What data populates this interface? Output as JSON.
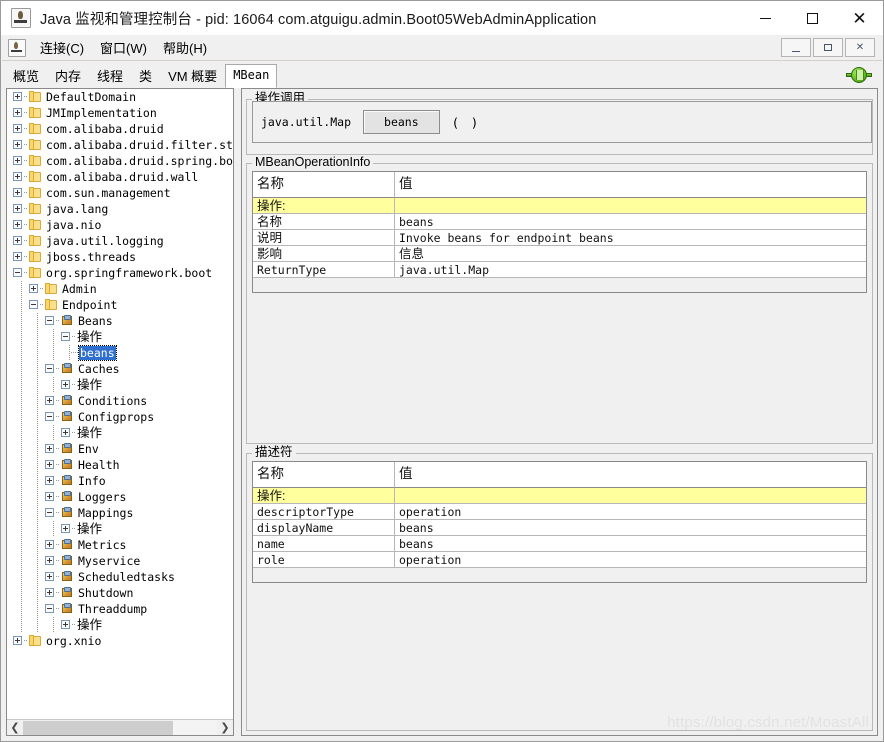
{
  "window": {
    "title": "Java 监视和管理控制台 - pid: 16064 com.atguigu.admin.Boot05WebAdminApplication",
    "app_icon": "java-cup-icon",
    "controls": {
      "minimize": "minimize-icon",
      "maximize": "maximize-icon",
      "close": "close-icon"
    }
  },
  "menubar": {
    "icon": "java-cup-icon",
    "items": [
      {
        "label": "连接(C)",
        "mnemonic": "C"
      },
      {
        "label": "窗口(W)",
        "mnemonic": "W"
      },
      {
        "label": "帮助(H)",
        "mnemonic": "H"
      }
    ],
    "internal_controls": {
      "minimize": "minimize-icon",
      "restore": "restore-icon",
      "close": "close-icon"
    }
  },
  "tabs": {
    "items": [
      {
        "label": "概览",
        "selected": false
      },
      {
        "label": "内存",
        "selected": false
      },
      {
        "label": "线程",
        "selected": false
      },
      {
        "label": "类",
        "selected": false
      },
      {
        "label": "VM 概要",
        "selected": false
      },
      {
        "label": "MBean",
        "selected": true
      }
    ],
    "status_icon": "connected-plug-icon"
  },
  "tree": {
    "nodes": [
      {
        "label": "DefaultDomain",
        "depth": 0,
        "handle": "plus",
        "icon": "folder"
      },
      {
        "label": "JMImplementation",
        "depth": 0,
        "handle": "plus",
        "icon": "folder"
      },
      {
        "label": "com.alibaba.druid",
        "depth": 0,
        "handle": "plus",
        "icon": "folder"
      },
      {
        "label": "com.alibaba.druid.filter.stat",
        "depth": 0,
        "handle": "plus",
        "icon": "folder"
      },
      {
        "label": "com.alibaba.druid.spring.boot.au",
        "depth": 0,
        "handle": "plus",
        "icon": "folder"
      },
      {
        "label": "com.alibaba.druid.wall",
        "depth": 0,
        "handle": "plus",
        "icon": "folder"
      },
      {
        "label": "com.sun.management",
        "depth": 0,
        "handle": "plus",
        "icon": "folder"
      },
      {
        "label": "java.lang",
        "depth": 0,
        "handle": "plus",
        "icon": "folder"
      },
      {
        "label": "java.nio",
        "depth": 0,
        "handle": "plus",
        "icon": "folder"
      },
      {
        "label": "java.util.logging",
        "depth": 0,
        "handle": "plus",
        "icon": "folder"
      },
      {
        "label": "jboss.threads",
        "depth": 0,
        "handle": "plus",
        "icon": "folder"
      },
      {
        "label": "org.springframework.boot",
        "depth": 0,
        "handle": "minus",
        "icon": "folder"
      },
      {
        "label": "Admin",
        "depth": 1,
        "handle": "plus",
        "icon": "folder"
      },
      {
        "label": "Endpoint",
        "depth": 1,
        "handle": "minus",
        "icon": "folder"
      },
      {
        "label": "Beans",
        "depth": 2,
        "handle": "minus",
        "icon": "mbean"
      },
      {
        "label": "操作",
        "depth": 3,
        "handle": "minus",
        "icon": "none",
        "cjk": true
      },
      {
        "label": "beans",
        "depth": 4,
        "handle": "none",
        "icon": "none",
        "selected": true
      },
      {
        "label": "Caches",
        "depth": 2,
        "handle": "minus",
        "icon": "mbean"
      },
      {
        "label": "操作",
        "depth": 3,
        "handle": "plus",
        "icon": "none",
        "cjk": true
      },
      {
        "label": "Conditions",
        "depth": 2,
        "handle": "plus",
        "icon": "mbean"
      },
      {
        "label": "Configprops",
        "depth": 2,
        "handle": "minus",
        "icon": "mbean"
      },
      {
        "label": "操作",
        "depth": 3,
        "handle": "plus",
        "icon": "none",
        "cjk": true
      },
      {
        "label": "Env",
        "depth": 2,
        "handle": "plus",
        "icon": "mbean"
      },
      {
        "label": "Health",
        "depth": 2,
        "handle": "plus",
        "icon": "mbean"
      },
      {
        "label": "Info",
        "depth": 2,
        "handle": "plus",
        "icon": "mbean"
      },
      {
        "label": "Loggers",
        "depth": 2,
        "handle": "plus",
        "icon": "mbean"
      },
      {
        "label": "Mappings",
        "depth": 2,
        "handle": "minus",
        "icon": "mbean"
      },
      {
        "label": "操作",
        "depth": 3,
        "handle": "plus",
        "icon": "none",
        "cjk": true
      },
      {
        "label": "Metrics",
        "depth": 2,
        "handle": "plus",
        "icon": "mbean"
      },
      {
        "label": "Myservice",
        "depth": 2,
        "handle": "plus",
        "icon": "mbean"
      },
      {
        "label": "Scheduledtasks",
        "depth": 2,
        "handle": "plus",
        "icon": "mbean"
      },
      {
        "label": "Shutdown",
        "depth": 2,
        "handle": "plus",
        "icon": "mbean"
      },
      {
        "label": "Threaddump",
        "depth": 2,
        "handle": "minus",
        "icon": "mbean"
      },
      {
        "label": "操作",
        "depth": 3,
        "handle": "plus",
        "icon": "none",
        "cjk": true
      },
      {
        "label": "org.xnio",
        "depth": 0,
        "handle": "plus",
        "icon": "folder"
      }
    ],
    "hscroll": {
      "left_arrow": "chevron-left-icon",
      "right_arrow": "chevron-right-icon"
    }
  },
  "operation_invocation": {
    "group_label": "操作调用",
    "return_type": "java.util.Map",
    "button_label": "beans",
    "parens": "( )"
  },
  "mbean_operation_info": {
    "group_label": "MBeanOperationInfo",
    "columns": [
      "名称",
      "值"
    ],
    "rows": [
      {
        "name": "操作:",
        "value": "",
        "highlight": true,
        "cjk_name": true
      },
      {
        "name": "名称",
        "value": "beans",
        "highlight": false,
        "cjk_name": true
      },
      {
        "name": "说明",
        "value": "Invoke beans for endpoint beans",
        "highlight": false,
        "cjk_name": true
      },
      {
        "name": "影响",
        "value": "信息",
        "highlight": false,
        "cjk_name": true,
        "cjk_value": true
      },
      {
        "name": "ReturnType",
        "value": "java.util.Map",
        "highlight": false,
        "cjk_name": false
      }
    ]
  },
  "descriptor": {
    "group_label": "描述符",
    "columns": [
      "名称",
      "值"
    ],
    "rows": [
      {
        "name": "操作:",
        "value": "",
        "highlight": true,
        "cjk_name": true
      },
      {
        "name": "descriptorType",
        "value": "operation",
        "highlight": false,
        "cjk_name": false
      },
      {
        "name": "displayName",
        "value": "beans",
        "highlight": false,
        "cjk_name": false
      },
      {
        "name": "name",
        "value": "beans",
        "highlight": false,
        "cjk_name": false
      },
      {
        "name": "role",
        "value": "operation",
        "highlight": false,
        "cjk_name": false
      }
    ]
  },
  "watermark": {
    "text": "https://blog.csdn.net/MoastAll"
  },
  "colors": {
    "highlight_row": "#ffff9e",
    "selection": "#2f6fd0",
    "folder": "#fbe08a",
    "connected": "#6fc72c"
  }
}
